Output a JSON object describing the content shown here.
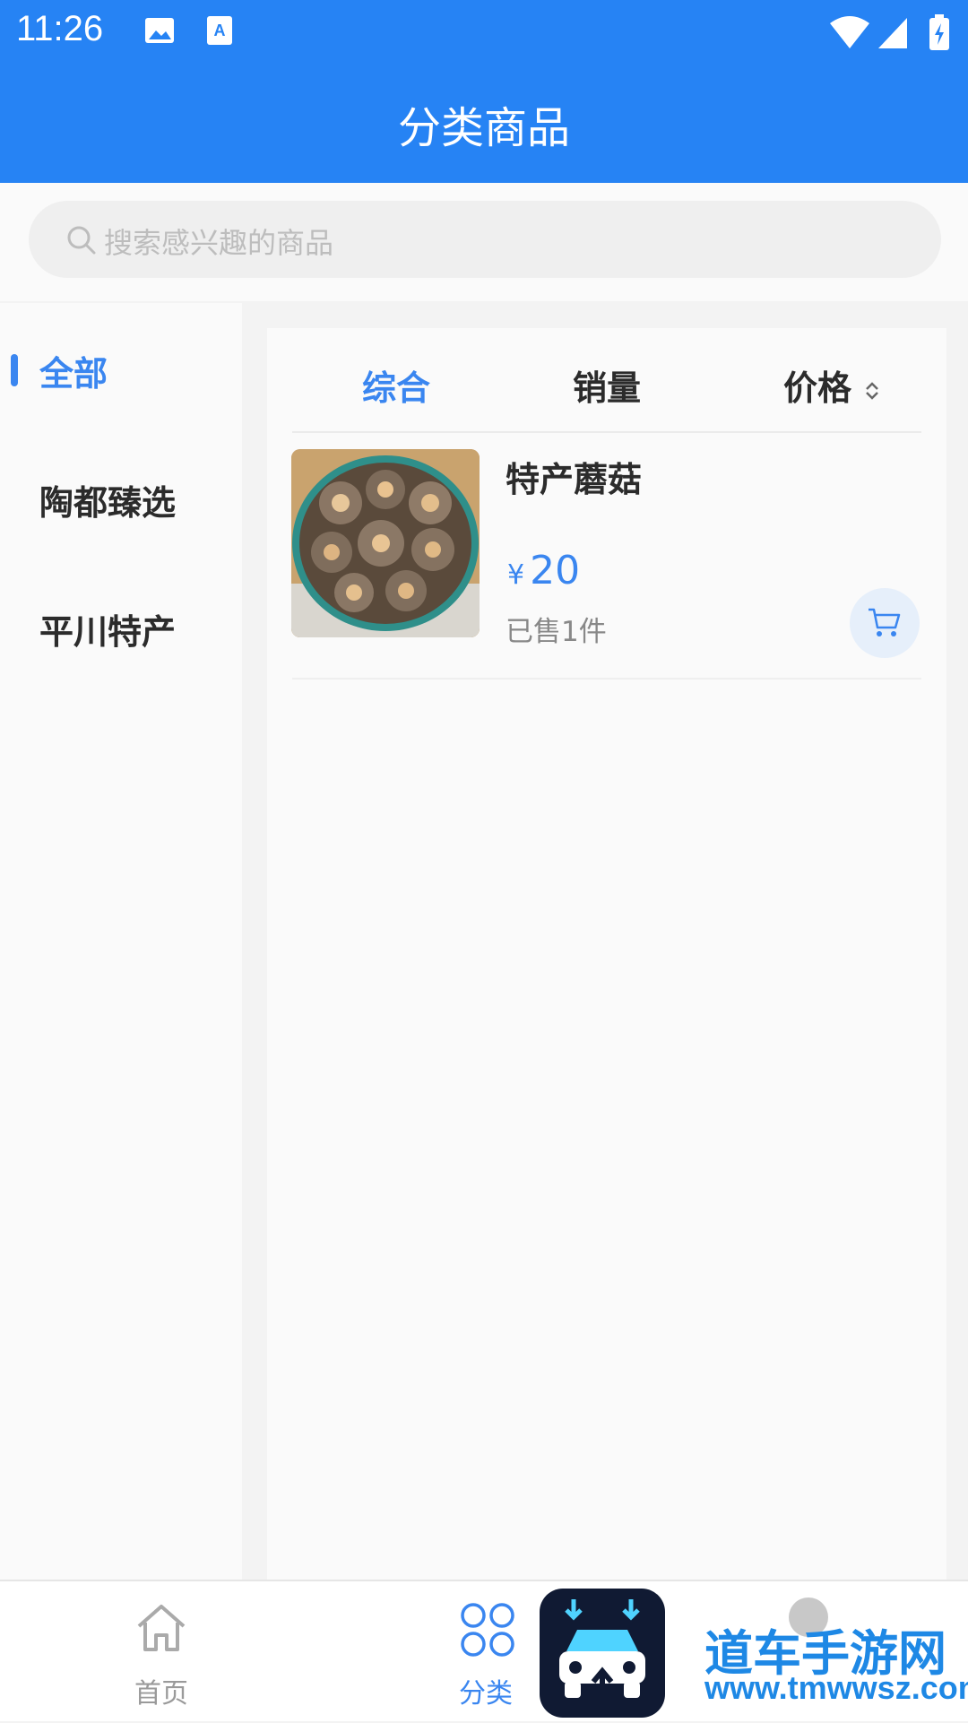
{
  "status_bar": {
    "time": "11:26"
  },
  "header": {
    "title": "分类商品"
  },
  "search": {
    "placeholder": "搜索感兴趣的商品"
  },
  "sidebar": {
    "items": [
      {
        "label": "全部",
        "active": true
      },
      {
        "label": "陶都臻选",
        "active": false
      },
      {
        "label": "平川特产",
        "active": false
      }
    ]
  },
  "sort_tabs": [
    {
      "label": "综合",
      "active": true
    },
    {
      "label": "销量",
      "active": false
    },
    {
      "label": "价格",
      "active": false
    }
  ],
  "products": [
    {
      "name": "特产蘑菇",
      "currency": "¥",
      "price": "20",
      "sold": "已售1件"
    }
  ],
  "tabbar": {
    "items": [
      {
        "label": "首页",
        "active": false
      },
      {
        "label": "分类",
        "active": true
      }
    ]
  },
  "watermark": {
    "line1": "道车手游网",
    "line2": "www.tmwwsz.com"
  },
  "colors": {
    "primary": "#2683f4",
    "accent": "#3a86f0"
  }
}
